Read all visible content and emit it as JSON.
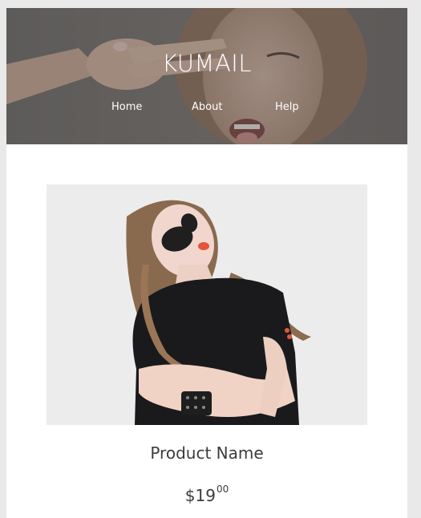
{
  "header": {
    "brand": "KUMAIL",
    "nav": [
      {
        "label": "Home"
      },
      {
        "label": "About"
      },
      {
        "label": "Help"
      }
    ]
  },
  "product": {
    "name": "Product Name",
    "currency": "$",
    "price_whole": "19",
    "price_cents": "00"
  },
  "colors": {
    "page_background": "#e9e9e9",
    "card_background": "#ffffff",
    "hero_overlay": "#5e5a58",
    "text": "#3c3c3c",
    "nav_text": "#ffffff"
  }
}
